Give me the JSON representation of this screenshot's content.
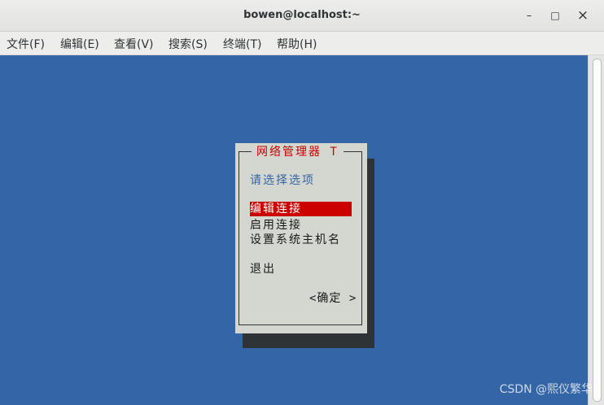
{
  "window": {
    "title": "bowen@localhost:~",
    "controls": {
      "minimize": "–",
      "maximize": "□",
      "close": "×"
    }
  },
  "menubar": [
    {
      "label": "文件(F)"
    },
    {
      "label": "编辑(E)"
    },
    {
      "label": "查看(V)"
    },
    {
      "label": "搜索(S)"
    },
    {
      "label": "终端(T)"
    },
    {
      "label": "帮助(H)"
    }
  ],
  "terminal": {
    "background": "#3465a6",
    "dialog": {
      "title": "网络管理器 T",
      "prompt": "请选择选项",
      "options": [
        {
          "label": "编辑连接",
          "selected": true
        },
        {
          "label": "启用连接",
          "selected": false
        },
        {
          "label": "设置系统主机名",
          "selected": false
        },
        {
          "label": "退出",
          "selected": false
        }
      ],
      "ok_button": "<确定 >"
    }
  },
  "watermark": "CSDN @熙仪繁华"
}
